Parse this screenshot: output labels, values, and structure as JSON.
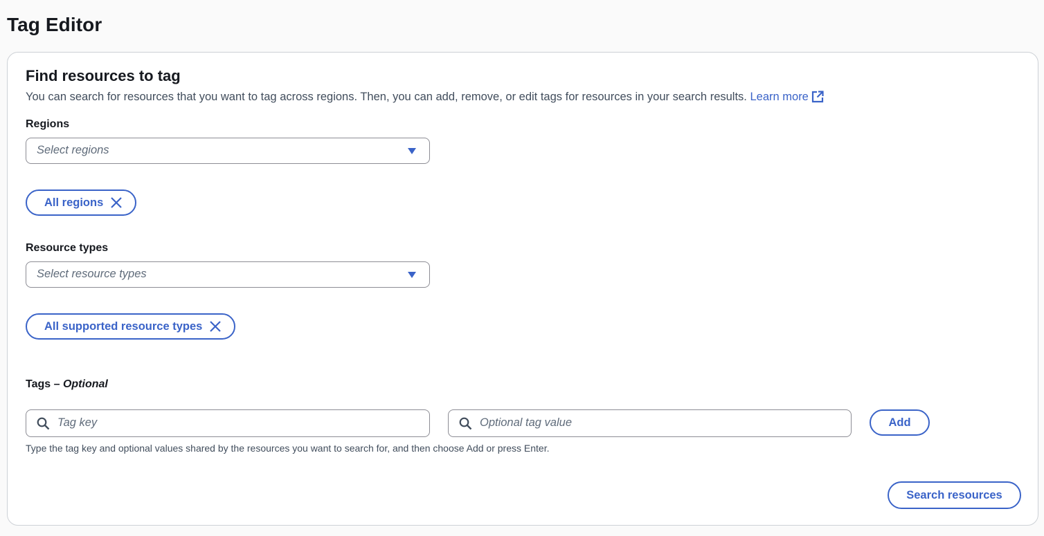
{
  "page": {
    "title": "Tag Editor"
  },
  "panel": {
    "title": "Find resources to tag",
    "description": "You can search for resources that you want to tag across regions. Then, you can add, remove, or edit tags for resources in your search results.",
    "learn_more": "Learn more"
  },
  "regions": {
    "label": "Regions",
    "placeholder": "Select regions",
    "token": "All regions"
  },
  "resource_types": {
    "label": "Resource types",
    "placeholder": "Select resource types",
    "token": "All supported resource types"
  },
  "tags": {
    "label": "Tags",
    "label_separator": " – ",
    "label_optional": "Optional",
    "key_placeholder": "Tag key",
    "value_placeholder": "Optional tag value",
    "add_label": "Add",
    "hint": "Type the tag key and optional values shared by the resources you want to search for, and then choose Add or press Enter."
  },
  "actions": {
    "search_label": "Search resources"
  },
  "colors": {
    "accent": "#3a63c8",
    "border": "#8c8c94",
    "panel_border": "#cdd1d6"
  }
}
